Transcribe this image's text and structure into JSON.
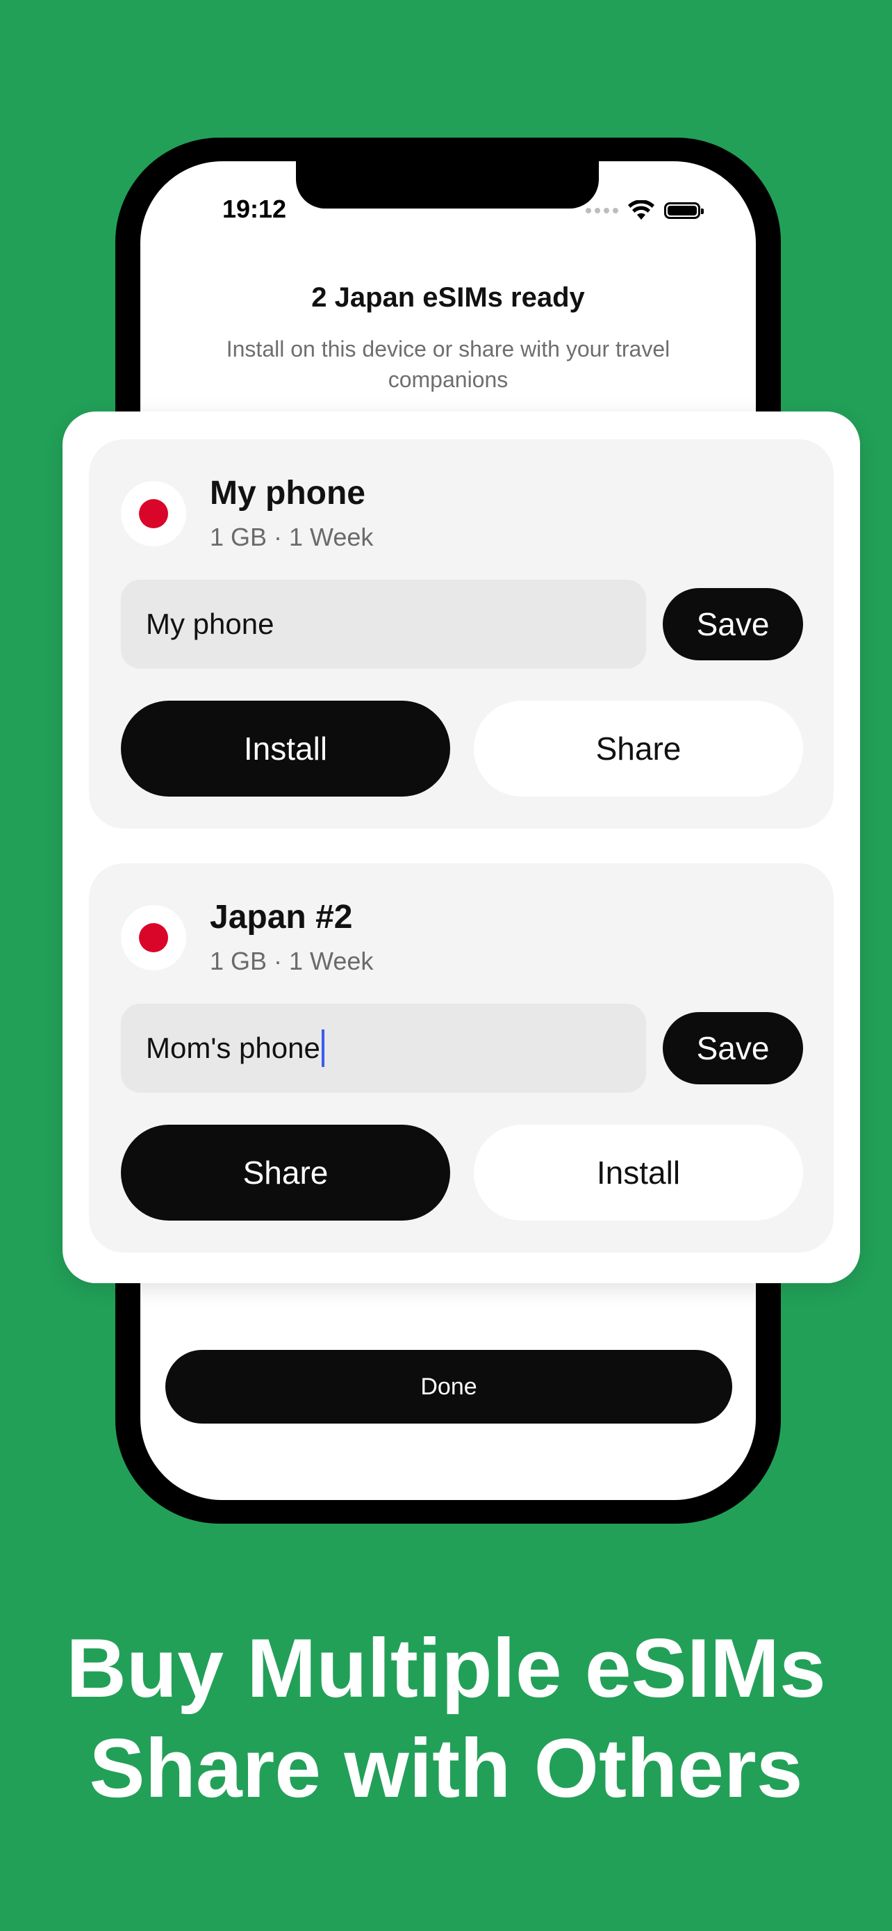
{
  "status_bar": {
    "time": "19:12"
  },
  "screen": {
    "title": "2 Japan eSIMs ready",
    "subtitle": "Install on this device or share with your travel companions",
    "done_label": "Done"
  },
  "esims": [
    {
      "name": "My phone",
      "plan": "1 GB · 1 Week",
      "input_value": "My phone",
      "save_label": "Save",
      "primary_action": "Install",
      "secondary_action": "Share"
    },
    {
      "name": "Japan #2",
      "plan": "1 GB · 1 Week",
      "input_value": "Mom's phone",
      "save_label": "Save",
      "primary_action": "Share",
      "secondary_action": "Install"
    }
  ],
  "headline": {
    "line1": "Buy Multiple eSIMs",
    "line2": "Share with Others"
  },
  "colors": {
    "background": "#22a058",
    "flag_red": "#d9062a",
    "caret": "#3d5cf0"
  },
  "icons": {
    "flag": "japan-flag-icon",
    "wifi": "wifi-icon",
    "battery": "battery-icon",
    "signal": "cellular-signal-icon"
  }
}
